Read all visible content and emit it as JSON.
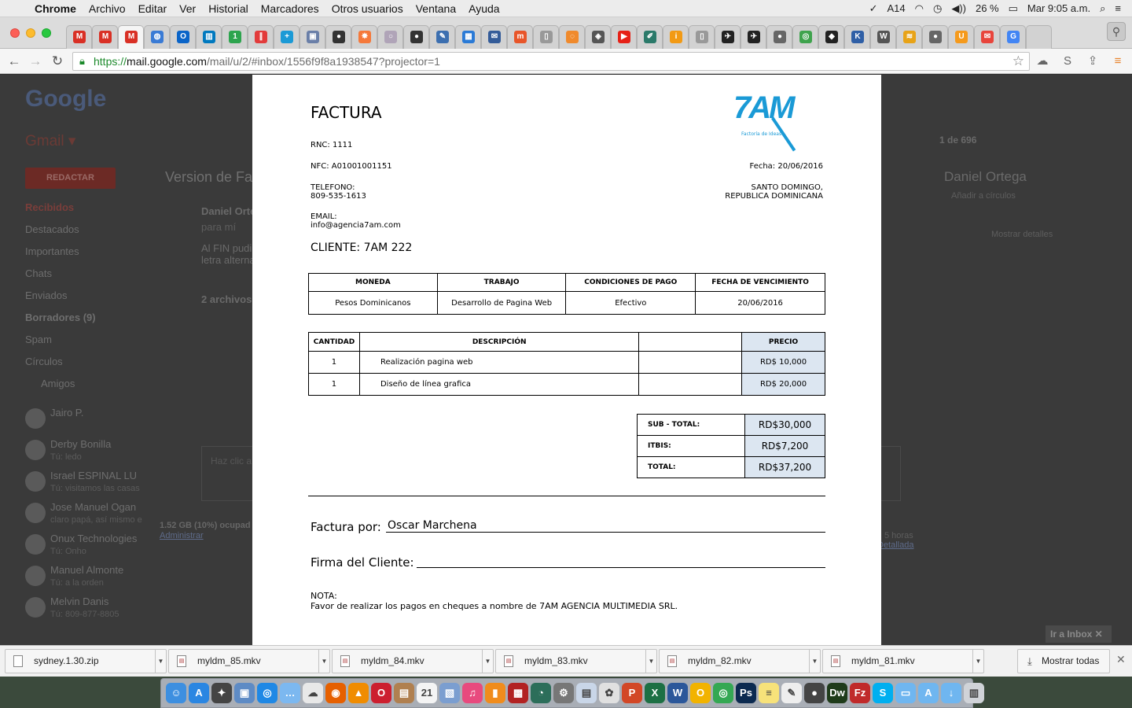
{
  "menubar": {
    "apple": "",
    "items": [
      "Chrome",
      "Archivo",
      "Editar",
      "Ver",
      "Historial",
      "Marcadores",
      "Otros usuarios",
      "Ventana",
      "Ayuda"
    ],
    "status": {
      "adobe": "14",
      "battery": "26 %",
      "clock": "Mar 9:05 a.m."
    }
  },
  "tabs": [
    {
      "icon": "gmail-icon",
      "glyph": "M",
      "color": "#d93025"
    },
    {
      "icon": "gmail-icon",
      "glyph": "M",
      "color": "#d93025"
    },
    {
      "icon": "gmail-icon",
      "glyph": "M",
      "color": "#d93025"
    },
    {
      "icon": "globe-icon",
      "glyph": "◍",
      "color": "#3a7bd5"
    },
    {
      "icon": "outlook-icon",
      "glyph": "O",
      "color": "#0a64c8"
    },
    {
      "icon": "trello-icon",
      "glyph": "▥",
      "color": "#0079bf"
    },
    {
      "icon": "one-icon",
      "glyph": "1",
      "color": "#2da44e"
    },
    {
      "icon": "pause-icon",
      "glyph": "∥",
      "color": "#e23b3b"
    },
    {
      "icon": "plus-icon",
      "glyph": "+",
      "color": "#1b9ad6"
    },
    {
      "icon": "bus-icon",
      "glyph": "▣",
      "color": "#6a7fa8"
    },
    {
      "icon": "github-icon",
      "glyph": "●",
      "color": "#333333"
    },
    {
      "icon": "hubspot-icon",
      "glyph": "✸",
      "color": "#f5793b"
    },
    {
      "icon": "circle-icon",
      "glyph": "○",
      "color": "#b0a4b8"
    },
    {
      "icon": "github-icon",
      "glyph": "●",
      "color": "#333333"
    },
    {
      "icon": "edit-icon",
      "glyph": "✎",
      "color": "#3c6fb0"
    },
    {
      "icon": "calendar-icon",
      "glyph": "▦",
      "color": "#2a7ad6"
    },
    {
      "icon": "mail-icon",
      "glyph": "✉",
      "color": "#345c99"
    },
    {
      "icon": "m-icon",
      "glyph": "m",
      "color": "#e8562a"
    },
    {
      "icon": "document-icon",
      "glyph": "▯",
      "color": "#999999"
    },
    {
      "icon": "ring-icon",
      "glyph": "◌",
      "color": "#f08a2c"
    },
    {
      "icon": "cube-icon",
      "glyph": "◈",
      "color": "#555555"
    },
    {
      "icon": "youtube-icon",
      "glyph": "▶",
      "color": "#e62117"
    },
    {
      "icon": "pen-icon",
      "glyph": "✐",
      "color": "#2b7a6a"
    },
    {
      "icon": "info-icon",
      "glyph": "i",
      "color": "#f29a14"
    },
    {
      "icon": "document-icon",
      "glyph": "▯",
      "color": "#999999"
    },
    {
      "icon": "bird-icon",
      "glyph": "✈",
      "color": "#222222"
    },
    {
      "icon": "bird-icon",
      "glyph": "✈",
      "color": "#222222"
    },
    {
      "icon": "octocat-icon",
      "glyph": "●",
      "color": "#666666"
    },
    {
      "icon": "chrome-ring-icon",
      "glyph": "◎",
      "color": "#3fa34d"
    },
    {
      "icon": "shield-icon",
      "glyph": "◆",
      "color": "#222222"
    },
    {
      "icon": "k-icon",
      "glyph": "K",
      "color": "#2f5fa6"
    },
    {
      "icon": "wikipedia-icon",
      "glyph": "W",
      "color": "#555555"
    },
    {
      "icon": "pma-icon",
      "glyph": "≋",
      "color": "#e8a317"
    },
    {
      "icon": "octocat-icon",
      "glyph": "●",
      "color": "#666666"
    },
    {
      "icon": "shield-orange-icon",
      "glyph": "U",
      "color": "#f59a1c"
    },
    {
      "icon": "envelope-red-icon",
      "glyph": "✉",
      "color": "#e8453c"
    },
    {
      "icon": "google-icon",
      "glyph": "G",
      "color": "#4285f4"
    },
    {
      "icon": "new-tab-icon",
      "glyph": "",
      "color": "#d2d2d2"
    }
  ],
  "toolbar": {
    "url_scheme": "https://",
    "url_host": "mail.google.com",
    "url_path": "/mail/u/2/#inbox/1556f9f8a1938547?projector=1"
  },
  "gmail": {
    "logo": "Google",
    "app_label": "Gmail ▾",
    "compose": "REDACTAR",
    "sidebar": [
      "Recibidos",
      "Destacados",
      "Importantes",
      "Chats",
      "Enviados",
      "Borradores (9)",
      "Spam",
      "Círculos",
      "Amigos"
    ],
    "contacts": [
      {
        "name": "Jairo P.",
        "status": ""
      },
      {
        "name": "Derby Bonilla",
        "status": "Tú: ledo"
      },
      {
        "name": "Israel ESPINAL LU",
        "status": "Tú: visitamos las casas"
      },
      {
        "name": "Jose Manuel Ogan",
        "status": "claro papá, así mismo e"
      },
      {
        "name": "Onux Technologies",
        "status": "Tú: Onho"
      },
      {
        "name": "Manuel Almonte",
        "status": "Tú: a la orden"
      },
      {
        "name": "Melvin Danis",
        "status": "Tú: 809-877-8805"
      }
    ],
    "subject": "Version de Fa",
    "sender": "Daniel Orte",
    "to_me": "para mí",
    "body_line1": "Al FIN pudi",
    "body_line2": "letra alterna",
    "attachments": "2 archivos",
    "storage": "1.52 GB (10%) ocupad",
    "admin": "Administrar",
    "counter": "1 de 696",
    "contact_name": "Daniel Ortega",
    "add_circles": "Añadir a círculos",
    "more_details": "Mostrar detalles",
    "hours": "5 horas",
    "details": "Detallada",
    "inbox_tag": "Ir a Inbox ✕",
    "reply_placeholder": "Haz clic a"
  },
  "invoice": {
    "title": "FACTURA",
    "logo_text": "7AM",
    "logo_slogan": "Factoría de Ideas",
    "rnc": "RNC: 1111",
    "nfc": "NFC: A01001001151",
    "fecha": "Fecha: 20/06/2016",
    "telefono_label": "TELEFONO:",
    "telefono": "809-535-1613",
    "city": "SANTO DOMINGO,",
    "country": "REPUBLICA DOMINICANA",
    "email_label": "EMAIL:",
    "email": "info@agencia7am.com",
    "cliente": "CLIENTE: 7AM 222",
    "terms_headers": [
      "MONEDA",
      "TRABAJO",
      "CONDICIONES DE PAGO",
      "FECHA DE VENCIMIENTO"
    ],
    "terms_values": [
      "Pesos Dominicanos",
      "Desarrollo de Pagina Web",
      "Efectivo",
      "20/06/2016"
    ],
    "items_headers": [
      "CANTIDAD",
      "DESCRIPCIÓN",
      "",
      "PRECIO"
    ],
    "items": [
      {
        "qty": "1",
        "desc": "Realización pagina web",
        "extra": "",
        "price": "RD$ 10,000"
      },
      {
        "qty": "1",
        "desc": "Diseño de línea grafica",
        "extra": "",
        "price": "RD$ 20,000"
      }
    ],
    "totals": [
      {
        "label": "SUB - TOTAL:",
        "value": "RD$30,000"
      },
      {
        "label": "ITBIS:",
        "value": "RD$7,200"
      },
      {
        "label": "TOTAL:",
        "value": "RD$37,200"
      }
    ],
    "factura_por_label": "Factura por:",
    "factura_por_name": "Oscar Marchena",
    "firma_label": "Firma del Cliente:",
    "nota_label": "NOTA:",
    "nota_text": "Favor de realizar los pagos en cheques a nombre de 7AM AGENCIA MULTIMEDIA SRL."
  },
  "downloads": {
    "items": [
      "sydney.1.30.zip",
      "myldm_85.mkv",
      "myldm_84.mkv",
      "myldm_83.mkv",
      "myldm_82.mkv",
      "myldm_81.mkv"
    ],
    "show_all": "Mostrar todas"
  },
  "dock": [
    {
      "icon": "finder-icon",
      "color": "#3d8fe0",
      "glyph": "☺"
    },
    {
      "icon": "app-store-icon",
      "color": "#2a86e2",
      "glyph": "A"
    },
    {
      "icon": "launchpad-icon",
      "color": "#444444",
      "glyph": "✦"
    },
    {
      "icon": "preview-icon",
      "color": "#5e8bc5",
      "glyph": "▣"
    },
    {
      "icon": "safari-icon",
      "color": "#1f88e5",
      "glyph": "◎"
    },
    {
      "icon": "messages-icon",
      "color": "#7cb8f0",
      "glyph": "…"
    },
    {
      "icon": "sheep-icon",
      "color": "#e8e8e8",
      "glyph": "☁"
    },
    {
      "icon": "firefox-icon",
      "color": "#e66000",
      "glyph": "◉"
    },
    {
      "icon": "vlc-icon",
      "color": "#f08c00",
      "glyph": "▲"
    },
    {
      "icon": "opera-icon",
      "color": "#cc1f2f",
      "glyph": "O"
    },
    {
      "icon": "box-icon",
      "color": "#b08050",
      "glyph": "▤"
    },
    {
      "icon": "calendar-icon",
      "color": "#f4f4f4",
      "glyph": "21"
    },
    {
      "icon": "photos-icon",
      "color": "#7b9ed0",
      "glyph": "▧"
    },
    {
      "icon": "itunes-icon",
      "color": "#e84a7e",
      "glyph": "♫"
    },
    {
      "icon": "ibooks-icon",
      "color": "#f08c1c",
      "glyph": "▮"
    },
    {
      "icon": "photobooth-icon",
      "color": "#b22222",
      "glyph": "▩"
    },
    {
      "icon": "time-machine-icon",
      "color": "#2c6e5a",
      "glyph": "◔"
    },
    {
      "icon": "system-prefs-icon",
      "color": "#777777",
      "glyph": "⚙"
    },
    {
      "icon": "preview-2-icon",
      "color": "#c9d6e8",
      "glyph": "▤"
    },
    {
      "icon": "pinwheel-icon",
      "color": "#e0e0e0",
      "glyph": "✿"
    },
    {
      "icon": "powerpoint-icon",
      "color": "#d24726",
      "glyph": "P"
    },
    {
      "icon": "excel-icon",
      "color": "#1d7044",
      "glyph": "X"
    },
    {
      "icon": "word-icon",
      "color": "#2b579a",
      "glyph": "W"
    },
    {
      "icon": "ring-app-icon",
      "color": "#f2b300",
      "glyph": "O"
    },
    {
      "icon": "chrome-icon",
      "color": "#34a853",
      "glyph": "◎"
    },
    {
      "icon": "photoshop-icon",
      "color": "#0c2a50",
      "glyph": "Ps"
    },
    {
      "icon": "notes-icon",
      "color": "#f7e27a",
      "glyph": "≡"
    },
    {
      "icon": "textedit-icon",
      "color": "#eeeeee",
      "glyph": "✎"
    },
    {
      "icon": "github-desktop-icon",
      "color": "#444444",
      "glyph": "●"
    },
    {
      "icon": "dreamweaver-icon",
      "color": "#1f3b1a",
      "glyph": "Dw"
    },
    {
      "icon": "filezilla-icon",
      "color": "#c02a2a",
      "glyph": "Fz"
    },
    {
      "icon": "skype-icon",
      "color": "#00aff0",
      "glyph": "S"
    },
    {
      "icon": "folder-icon",
      "color": "#6fb6f0",
      "glyph": "▭"
    },
    {
      "icon": "applications-folder-icon",
      "color": "#6fb6f0",
      "glyph": "A"
    },
    {
      "icon": "downloads-folder-icon",
      "color": "#6fb6f0",
      "glyph": "↓"
    },
    {
      "icon": "trash-icon",
      "color": "#d0d3d8",
      "glyph": "▥"
    }
  ]
}
